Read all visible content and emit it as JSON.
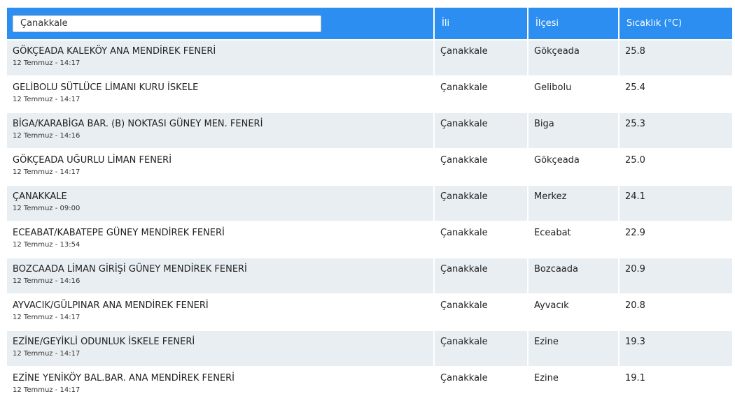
{
  "search": {
    "value": "Çanakkale"
  },
  "headers": {
    "province": "İli",
    "district": "İlçesi",
    "temperature": "Sıcaklık (°C)"
  },
  "rows": [
    {
      "station": "GÖKÇEADA KALEKÖY ANA MENDİREK FENERİ",
      "time": "12 Temmuz - 14:17",
      "province": "Çanakkale",
      "district": "Gökçeada",
      "temp": "25.8"
    },
    {
      "station": "GELİBOLU SÜTLÜCE LİMANI KURU İSKELE",
      "time": "12 Temmuz - 14:17",
      "province": "Çanakkale",
      "district": "Gelibolu",
      "temp": "25.4"
    },
    {
      "station": "BİGA/KARABİGA BAR. (B) NOKTASI GÜNEY MEN. FENERİ",
      "time": "12 Temmuz - 14:16",
      "province": "Çanakkale",
      "district": "Biga",
      "temp": "25.3"
    },
    {
      "station": "GÖKÇEADA UĞURLU LİMAN FENERİ",
      "time": "12 Temmuz - 14:17",
      "province": "Çanakkale",
      "district": "Gökçeada",
      "temp": "25.0"
    },
    {
      "station": "ÇANAKKALE",
      "time": "12 Temmuz - 09:00",
      "province": "Çanakkale",
      "district": "Merkez",
      "temp": "24.1"
    },
    {
      "station": "ECEABAT/KABATEPE GÜNEY MENDİREK FENERİ",
      "time": "12 Temmuz - 13:54",
      "province": "Çanakkale",
      "district": "Eceabat",
      "temp": "22.9"
    },
    {
      "station": "BOZCAADA LİMAN GİRİŞİ GÜNEY MENDİREK FENERİ",
      "time": "12 Temmuz - 14:16",
      "province": "Çanakkale",
      "district": "Bozcaada",
      "temp": "20.9"
    },
    {
      "station": "AYVACIK/GÜLPINAR ANA MENDİREK FENERİ",
      "time": "12 Temmuz - 14:17",
      "province": "Çanakkale",
      "district": "Ayvacık",
      "temp": "20.8"
    },
    {
      "station": "EZİNE/GEYİKLİ ODUNLUK İSKELE FENERİ",
      "time": "12 Temmuz - 14:17",
      "province": "Çanakkale",
      "district": "Ezine",
      "temp": "19.3"
    },
    {
      "station": "EZİNE YENİKÖY BAL.BAR. ANA MENDİREK FENERİ",
      "time": "12 Temmuz - 14:17",
      "province": "Çanakkale",
      "district": "Ezine",
      "temp": "19.1"
    }
  ],
  "colors": {
    "header_bg": "#2b8ef0",
    "row_alt_bg": "#e8eef2"
  }
}
